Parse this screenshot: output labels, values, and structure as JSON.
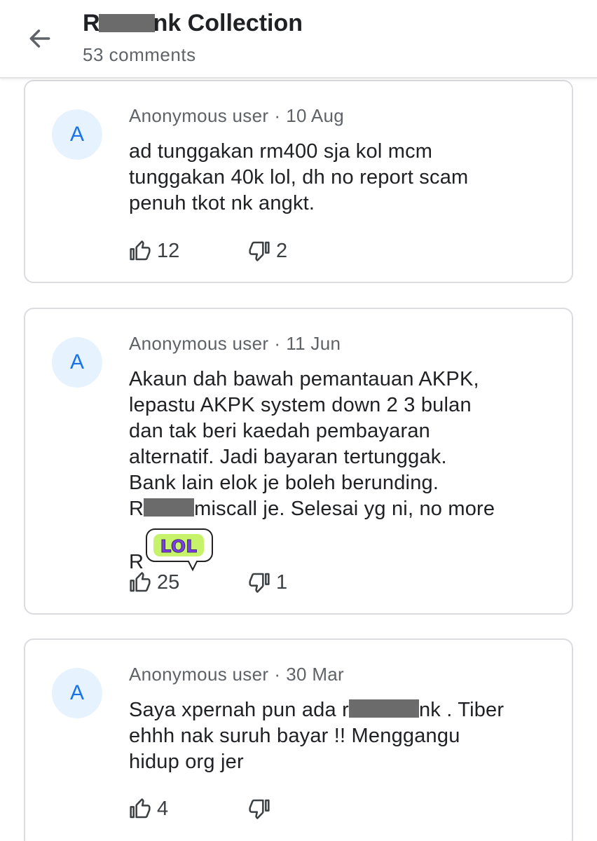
{
  "header": {
    "title_start": "R",
    "title_end": "nk Collection",
    "comment_count": "53 comments"
  },
  "comments": [
    {
      "avatar": "A",
      "author": "Anonymous user",
      "date": "10 Aug",
      "lines": [
        "ad tunggakan rm400 sja kol mcm",
        "tunggakan 40k lol, dh no report scam",
        "penuh tkot nk angkt."
      ],
      "likes": "12",
      "dislikes": "2"
    },
    {
      "avatar": "A",
      "author": "Anonymous user",
      "date": "11 Jun",
      "lines": [
        "Akaun dah bawah pemantauan AKPK,",
        "lepastu AKPK system down 2 3 bulan",
        "dan tak beri kaedah pembayaran",
        "alternatif. Jadi bayaran tertunggak.",
        "Bank lain elok je boleh berunding."
      ],
      "line6_start": "R",
      "line6_end": "miscall je. Selesai yg ni, no more",
      "line7_start": "R",
      "sticker_text": "LOL",
      "likes": "25",
      "dislikes": "1"
    },
    {
      "avatar": "A",
      "author": "Anonymous user",
      "date": "30 Mar",
      "line1_start": "Saya xpernah pun ada r",
      "line1_end": "nk . Tiber",
      "lines": [
        "ehhh nak suruh bayar !! Menggangu",
        "hidup org jer"
      ],
      "likes": "4",
      "dislikes": ""
    }
  ],
  "icons": {
    "back": "arrow-left-icon",
    "like": "thumb-up-icon",
    "dislike": "thumb-down-icon"
  },
  "colors": {
    "accent": "#1a73e8",
    "avatar_bg": "#e6f2fd",
    "sticker_purple": "#7b3fe4",
    "sticker_green": "#c6f36a"
  }
}
